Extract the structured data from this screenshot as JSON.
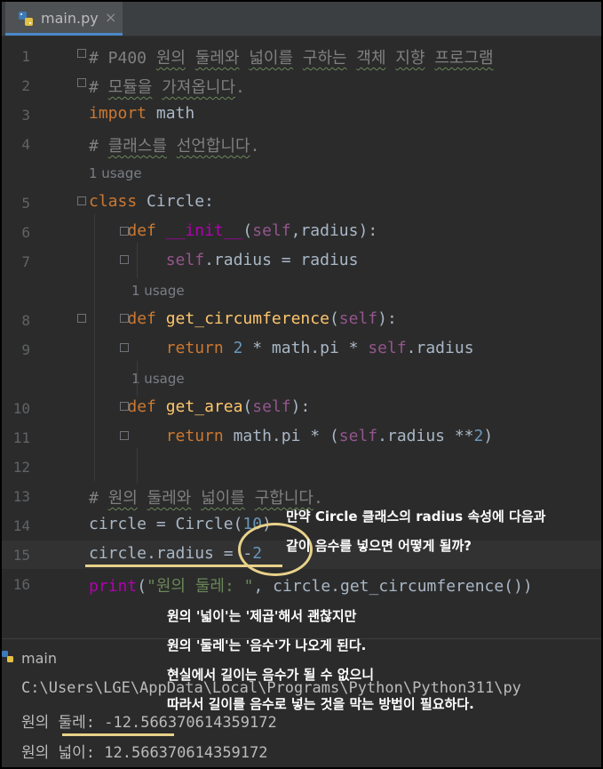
{
  "tab": {
    "filename": "main.py",
    "close": "×"
  },
  "lines": [
    {
      "n": "1",
      "html": "<span class=\"cm\"># P400 <span class=\"squig\">원의</span> <span class=\"squig\">둘레와</span> <span class=\"squig\">넓이를</span> <span class=\"squig\">구하는</span> <span class=\"squig\">객체</span> <span class=\"squig\">지향</span> <span class=\"squig\">프로그램</span></span>"
    },
    {
      "n": "2",
      "html": "<span class=\"cm\"># <span class=\"squig\">모듈을</span> <span class=\"squig\">가져옵니다</span>.</span>"
    },
    {
      "n": "3",
      "html": "<span class=\"kw\">import</span> math"
    },
    {
      "n": "4",
      "html": "<span class=\"cm\"># <span class=\"squig\">클래스를</span> <span class=\"squig\">선언합니다</span>.</span>"
    },
    {
      "n": "5",
      "html": "<span class=\"kw\">class</span> Circle:"
    },
    {
      "n": "6",
      "html": "    <span class=\"kw\">def</span> <span class=\"mag\">__init__</span>(<span class=\"self\">self</span>,radius):"
    },
    {
      "n": "7",
      "html": "        <span class=\"self\">self</span>.radius = radius"
    },
    {
      "n": "8",
      "html": "    <span class=\"kw\">def</span> <span class=\"fn\">get_circumference</span>(<span class=\"self\">self</span>):"
    },
    {
      "n": "9",
      "html": "        <span class=\"kw\">return</span> <span class=\"num\">2</span> * math.pi * <span class=\"self\">self</span>.radius"
    },
    {
      "n": "10",
      "html": "    <span class=\"kw\">def</span> <span class=\"fn\">get_area</span>(<span class=\"self\">self</span>):"
    },
    {
      "n": "11",
      "html": "        <span class=\"kw\">return</span> math.pi * (<span class=\"self\">self</span>.radius **<span class=\"num\">2</span>)"
    },
    {
      "n": "12",
      "html": ""
    },
    {
      "n": "13",
      "html": "<span class=\"cm\"># <span class=\"squig\">원의</span> <span class=\"squig\">둘레와</span> <span class=\"squig\">넓이를</span> <span class=\"squig\">구합니다</span>.</span>"
    },
    {
      "n": "14",
      "html": "circle = Circle(<span class=\"num\">10</span>)"
    },
    {
      "n": "15",
      "html": "circle.radius = -<span class=\"num\">2</span>"
    },
    {
      "n": "16",
      "html": "<span class=\"mag\">print</span>(<span class=\"str\">\"원의 둘레: \"</span>, circle.get_circumference())"
    }
  ],
  "usage_hints": [
    "1 usage",
    "1 usage",
    "1 usage"
  ],
  "run": {
    "name": "main"
  },
  "console": [
    "C:\\Users\\LGE\\AppData\\Local\\Programs\\Python\\Python311\\py",
    "원의 둘레: -12.566370614359172",
    "원의 넓이: 12.566370614359172"
  ],
  "annotations": {
    "a1": "만약 Circle 클래스의 radius 속성에 다음과",
    "a2": "같이 음수를 넣으면 어떻게 될까?",
    "b1": "원의 '넓이'는 '제곱'해서 괜찮지만",
    "b2": "원의 '둘레'는 '음수'가 나오게 된다.",
    "b3": "현실에서 길이는 음수가 될 수 없으니",
    "b4": "따라서 길이를 음수로 넣는 것을 막는 방법이 필요하다."
  },
  "colors": {
    "annotation_mark": "#e8d28a",
    "tab_accent": "#4a88c7"
  }
}
